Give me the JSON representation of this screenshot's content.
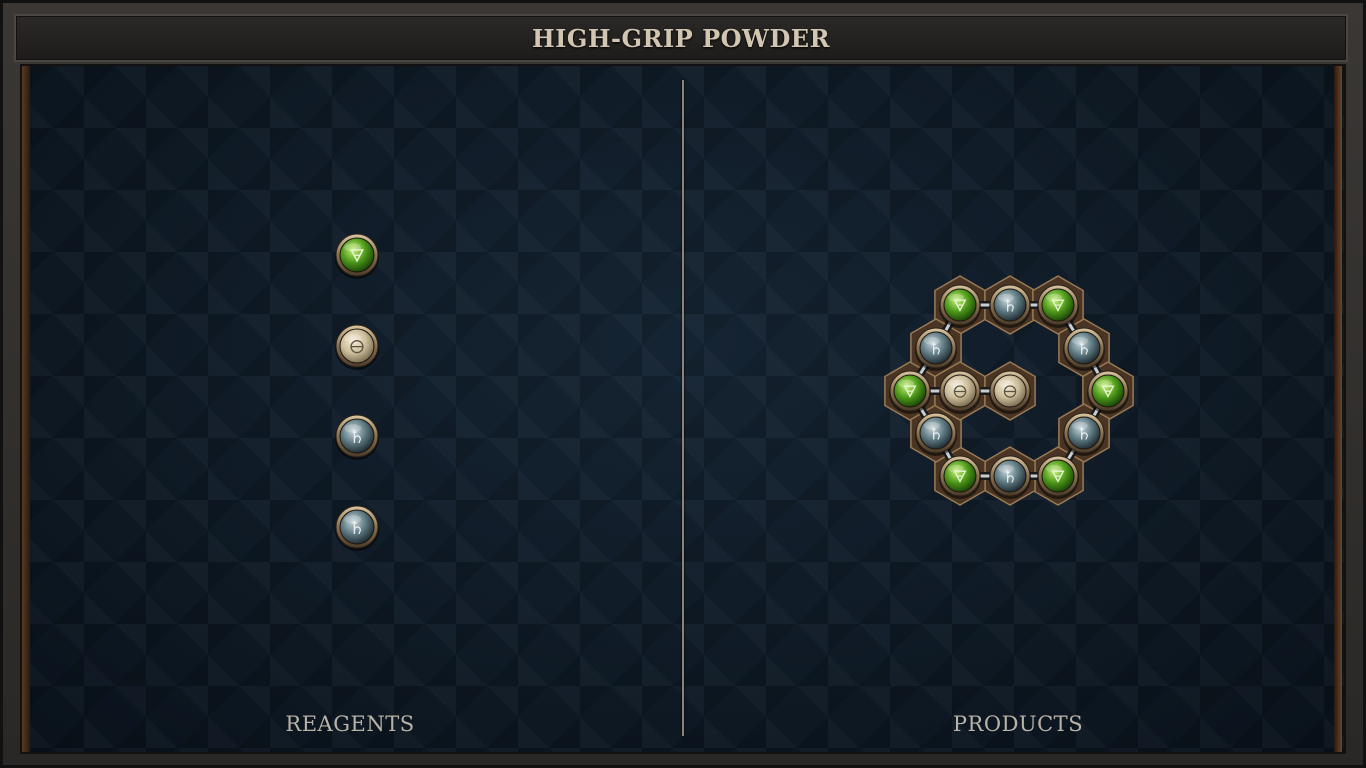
{
  "title": "HIGH-GRIP POWDER",
  "panels": {
    "reagents_label": "REAGENTS",
    "products_label": "PRODUCTS"
  },
  "elements": {
    "earth": {
      "glyph": "🜃",
      "colors": [
        "#c8f27a",
        "#4e9a1a",
        "#1d4a08"
      ],
      "glyph_color": "#e6f5d0"
    },
    "salt": {
      "glyph": "🜔",
      "colors": [
        "#f4ecd6",
        "#cdbf9c",
        "#7e7055"
      ],
      "glyph_color": "#5b5140"
    },
    "lead": {
      "glyph": "♄",
      "colors": [
        "#c7d6da",
        "#5f7a82",
        "#233037"
      ],
      "glyph_color": "#e8eef0"
    }
  },
  "reagents": [
    {
      "element": "earth"
    },
    {
      "element": "salt"
    },
    {
      "element": "lead"
    },
    {
      "element": "lead"
    }
  ],
  "product": {
    "atoms": [
      {
        "id": "a1",
        "element": "earth"
      },
      {
        "id": "a2",
        "element": "lead"
      },
      {
        "id": "a3",
        "element": "earth"
      },
      {
        "id": "a4",
        "element": "lead"
      },
      {
        "id": "a5",
        "element": "earth"
      },
      {
        "id": "a6",
        "element": "lead"
      },
      {
        "id": "a7",
        "element": "earth"
      },
      {
        "id": "a8",
        "element": "lead"
      },
      {
        "id": "a9",
        "element": "earth"
      },
      {
        "id": "a10",
        "element": "lead"
      },
      {
        "id": "a11",
        "element": "earth"
      },
      {
        "id": "a12",
        "element": "lead"
      },
      {
        "id": "s1",
        "element": "salt"
      },
      {
        "id": "s2",
        "element": "salt"
      }
    ],
    "bonds": [
      [
        "a1",
        "a2"
      ],
      [
        "a2",
        "a3"
      ],
      [
        "a3",
        "a4"
      ],
      [
        "a4",
        "a5"
      ],
      [
        "a5",
        "a6"
      ],
      [
        "a6",
        "a7"
      ],
      [
        "a7",
        "a8"
      ],
      [
        "a8",
        "a9"
      ],
      [
        "a9",
        "a10"
      ],
      [
        "a10",
        "a11"
      ],
      [
        "a11",
        "a12"
      ],
      [
        "a12",
        "a1"
      ],
      [
        "a11",
        "s1"
      ],
      [
        "s1",
        "s2"
      ]
    ]
  }
}
